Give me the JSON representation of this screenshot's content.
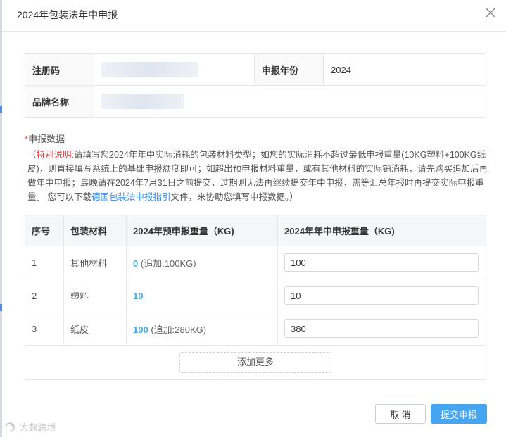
{
  "dialog": {
    "title": "2024年包装法年中申报"
  },
  "info": {
    "reg_label": "注册码",
    "year_label": "申报年份",
    "year_value": "2024",
    "brand_label": "品牌名称"
  },
  "section": {
    "required_mark": "*",
    "label": "申报数据"
  },
  "notice": {
    "open": "（",
    "highlight": "特别说明:",
    "text1": "请填写您2024年年中实际消耗的包装材料类型；如您的实际消耗不超过最低申报重量(10KG塑料+100KG纸皮)，则直接填写系统上的基础申报额度即可；如超出预申报材料重量，或有其他材料的实际销消耗，请先购买追加后再做年中申报；最晚请在2024年7月31日之前提交，过期则无法再继续提交年中申报，需等汇总年报时再提交实际申报重量。 您可以下载",
    "link": "德国包装法申报指引",
    "text2": "文件，来协助您填写申报数据。）"
  },
  "table": {
    "headers": [
      "序号",
      "包装材料",
      "2024年预申报重量（KG)",
      "2024年年中申报重量（KG)"
    ],
    "rows": [
      {
        "index": "1",
        "material": "其他材料",
        "pre_value": "0",
        "pre_extra": "(追加:100KG)",
        "mid_value": "100"
      },
      {
        "index": "2",
        "material": "塑料",
        "pre_value": "10",
        "pre_extra": "",
        "mid_value": "10"
      },
      {
        "index": "3",
        "material": "纸皮",
        "pre_value": "100",
        "pre_extra": "(追加:280KG)",
        "mid_value": "380"
      }
    ],
    "add_more": "添加更多"
  },
  "footer": {
    "cancel": "取 消",
    "submit": "提交申报"
  },
  "watermark": "大数跨境",
  "colors": {
    "accent": "#45a5f0",
    "link": "#3a8ee6",
    "required": "#e0393e",
    "number": "#44a8e0"
  },
  "icons": {
    "close": "close-icon",
    "watermark_logo": "dashuo-logo"
  }
}
